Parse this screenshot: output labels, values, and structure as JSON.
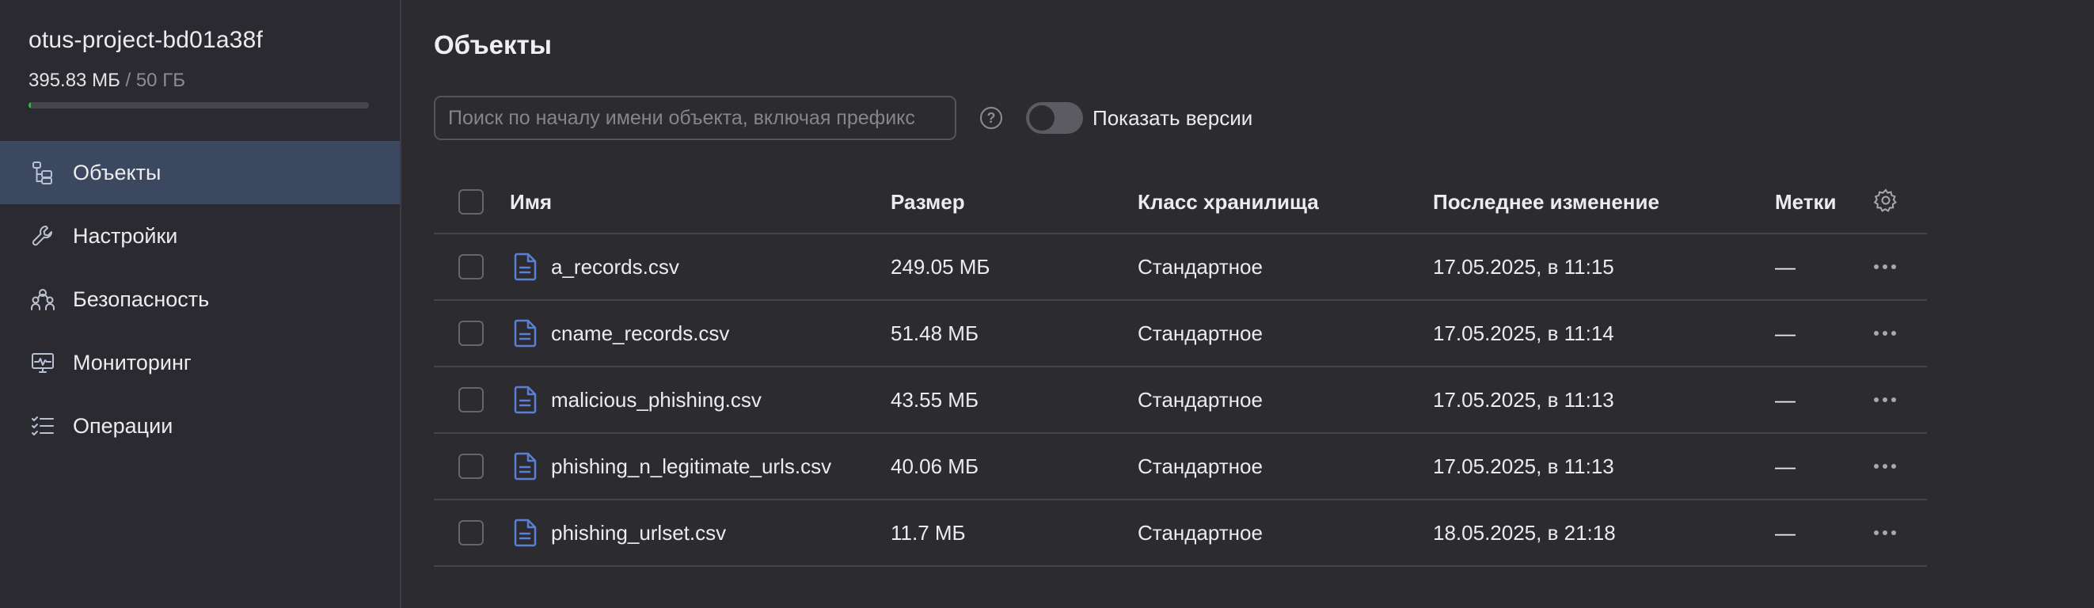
{
  "sidebar": {
    "bucket_name": "otus-project-bd01a38f",
    "usage_used": "395.83 МБ",
    "usage_total": " / 50 ГБ",
    "usage_fraction": 0.0077,
    "items": [
      {
        "label": "Объекты",
        "icon": "objects-tree-icon",
        "active": true
      },
      {
        "label": "Настройки",
        "icon": "wrench-icon",
        "active": false
      },
      {
        "label": "Безопасность",
        "icon": "users-icon",
        "active": false
      },
      {
        "label": "Мониторинг",
        "icon": "monitor-chart-icon",
        "active": false
      },
      {
        "label": "Операции",
        "icon": "checklist-icon",
        "active": false
      }
    ]
  },
  "main": {
    "title": "Объекты",
    "search_placeholder": "Поиск по началу имени объекта, включая префикс",
    "show_versions_label": "Показать версии",
    "show_versions_on": false
  },
  "table": {
    "headers": {
      "name": "Имя",
      "size": "Размер",
      "class": "Класс хранилища",
      "modified": "Последнее изменение",
      "tags": "Метки"
    },
    "rows": [
      {
        "name": "a_records.csv",
        "size": "249.05 МБ",
        "class": "Стандартное",
        "modified": "17.05.2025, в 11:15",
        "tags": "—"
      },
      {
        "name": "cname_records.csv",
        "size": "51.48 МБ",
        "class": "Стандартное",
        "modified": "17.05.2025, в 11:14",
        "tags": "—"
      },
      {
        "name": "malicious_phishing.csv",
        "size": "43.55 МБ",
        "class": "Стандартное",
        "modified": "17.05.2025, в 11:13",
        "tags": "—"
      },
      {
        "name": "phishing_n_legitimate_urls.csv",
        "size": "40.06 МБ",
        "class": "Стандартное",
        "modified": "17.05.2025, в 11:13",
        "tags": "—"
      },
      {
        "name": "phishing_urlset.csv",
        "size": "11.7 МБ",
        "class": "Стандартное",
        "modified": "18.05.2025, в 21:18",
        "tags": "—"
      }
    ]
  },
  "colors": {
    "accent": "#5b7fd6",
    "active_nav": "#3c4860",
    "usage_bar": "#36b24a"
  }
}
